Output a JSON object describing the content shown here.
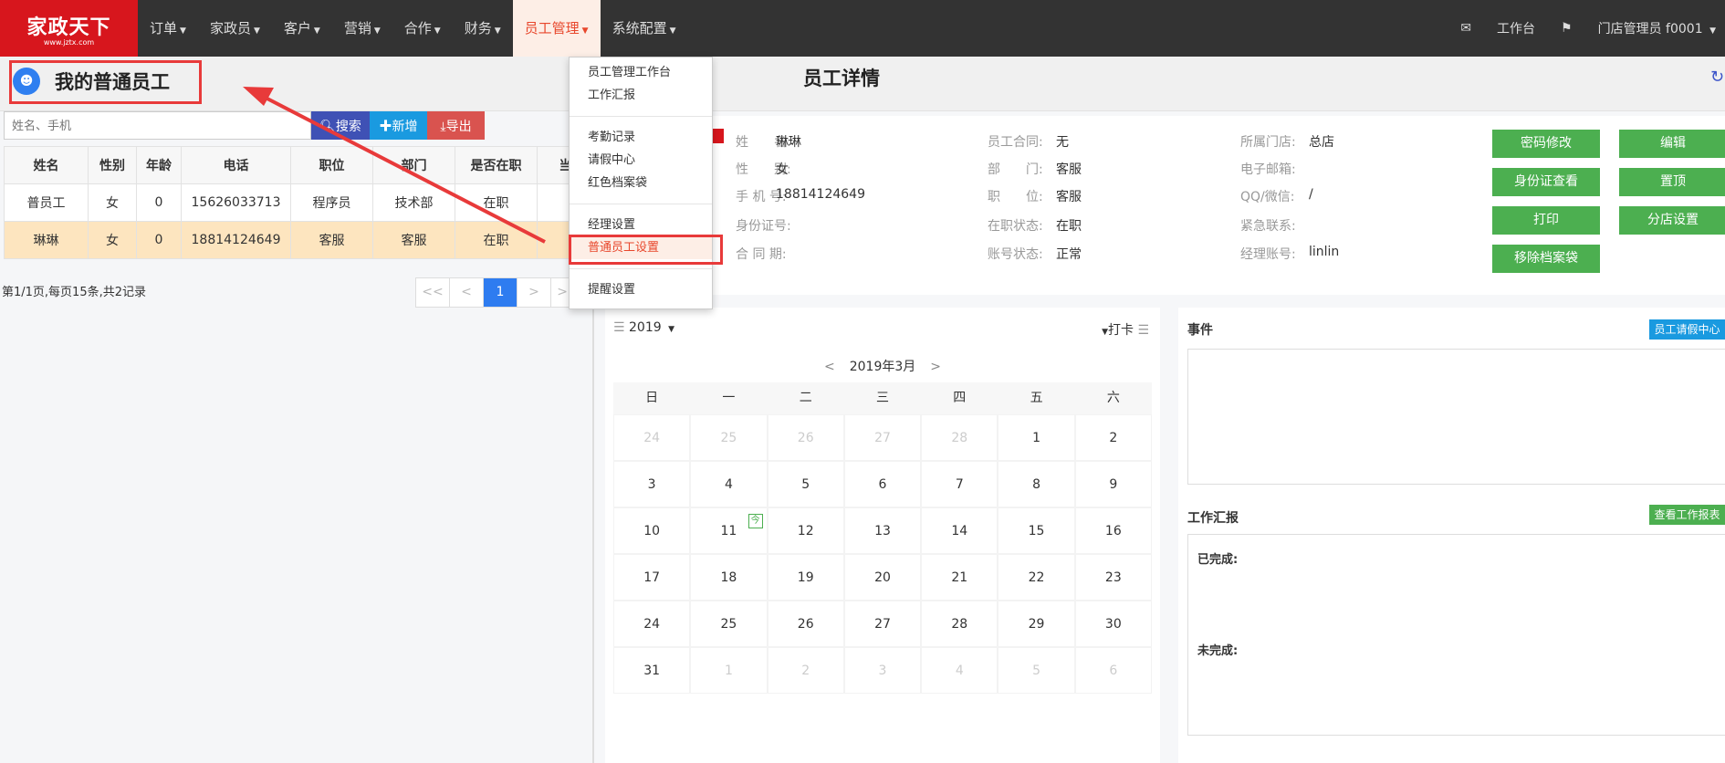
{
  "logo": {
    "text": "家政天下",
    "url_text": "www.jztx.com"
  },
  "nav": {
    "items": [
      "订单",
      "家政员",
      "客户",
      "营销",
      "合作",
      "财务",
      "员工管理",
      "系统配置"
    ],
    "active": "员工管理",
    "workbench": "工作台",
    "user": "门店管理员 f0001"
  },
  "left": {
    "title": "我的普通员工",
    "search_placeholder": "姓名、手机",
    "search": "搜索",
    "add": "新增",
    "export": "导出",
    "columns": [
      "姓名",
      "性别",
      "年龄",
      "电话",
      "职位",
      "部门",
      "是否在职",
      "当前"
    ],
    "rows": [
      [
        "普员工",
        "女",
        "0",
        "15626033713",
        "程序员",
        "技术部",
        "在职",
        "?"
      ],
      [
        "琳琳",
        "女",
        "0",
        "18814124649",
        "客服",
        "客服",
        "在职",
        "?"
      ]
    ],
    "page_info": "第1/1页,每页15条,共2记录",
    "pager": [
      "<<",
      "<",
      "1",
      ">",
      ">>"
    ]
  },
  "menu": {
    "groups": [
      [
        "员工管理工作台",
        "工作汇报"
      ],
      [
        "考勤记录",
        "请假中心",
        "红色档案袋"
      ],
      [
        "经理设置",
        "普通员工设置"
      ],
      [
        "提醒设置"
      ]
    ],
    "highlighted": "普通员工设置"
  },
  "detail": {
    "title": "员工详情",
    "fields": [
      [
        [
          "姓　　名:",
          "琳琳"
        ],
        [
          "性　　别:",
          "女"
        ],
        [
          "手 机 号:",
          "18814124649"
        ],
        [
          "身份证号:",
          ""
        ],
        [
          "合 同 期:",
          ""
        ]
      ],
      [
        [
          "员工合同:",
          "无"
        ],
        [
          "部　　门:",
          "客服"
        ],
        [
          "职　　位:",
          "客服"
        ],
        [
          "在职状态:",
          "在职"
        ],
        [
          "账号状态:",
          "正常"
        ]
      ],
      [
        [
          "所属门店:",
          "总店"
        ],
        [
          "电子邮箱:",
          ""
        ],
        [
          "QQ/微信:",
          "/"
        ],
        [
          "紧急联系:",
          ""
        ],
        [
          "经理账号:",
          "linlin"
        ]
      ]
    ],
    "buttons": [
      "密码修改",
      "编辑",
      "身份证查看",
      "置顶",
      "打印",
      "分店设置",
      "移除档案袋"
    ]
  },
  "calendar": {
    "year": "2019",
    "punch": "打卡",
    "month": "2019年3月",
    "weekdays": [
      "日",
      "一",
      "二",
      "三",
      "四",
      "五",
      "六"
    ],
    "days": [
      24,
      25,
      26,
      27,
      28,
      1,
      2,
      3,
      4,
      5,
      6,
      7,
      8,
      9,
      10,
      11,
      12,
      13,
      14,
      15,
      16,
      17,
      18,
      19,
      20,
      21,
      22,
      23,
      24,
      25,
      26,
      27,
      28,
      29,
      30,
      31,
      1,
      2,
      3,
      4,
      5,
      6
    ],
    "today": 11,
    "today_label": "今"
  },
  "events": {
    "title": "事件",
    "leave_btn": "员工请假中心",
    "report_title": "工作汇报",
    "report_btn": "查看工作报表",
    "done": "已完成:",
    "undone": "未完成:"
  },
  "colors": {
    "nav": "#333333",
    "brand": "#d7161d",
    "green": "#4caf50",
    "blue": "#1a9ae0",
    "annotation": "#e83a3a"
  }
}
